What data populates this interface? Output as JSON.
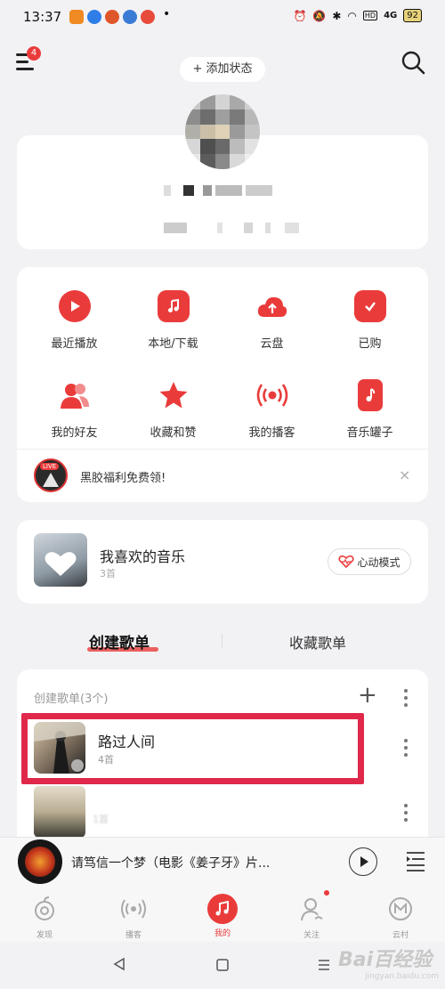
{
  "status_bar": {
    "time": "13:37",
    "dot": "•",
    "network": "4G",
    "hd": "HD",
    "battery": "92"
  },
  "header": {
    "menu_badge": "4",
    "add_status_label": "+ 添加状态"
  },
  "quick_grid": {
    "items": [
      {
        "label": "最近播放",
        "icon": "play-icon"
      },
      {
        "label": "本地/下载",
        "icon": "music-note-icon"
      },
      {
        "label": "云盘",
        "icon": "cloud-upload-icon"
      },
      {
        "label": "已购",
        "icon": "shopping-bag-icon"
      },
      {
        "label": "我的好友",
        "icon": "friends-icon"
      },
      {
        "label": "收藏和赞",
        "icon": "star-icon"
      },
      {
        "label": "我的播客",
        "icon": "podcast-icon"
      },
      {
        "label": "音乐罐子",
        "icon": "music-jar-icon"
      }
    ]
  },
  "promo": {
    "live_tag": "LIVE",
    "text": "黑胶福利免费领!",
    "close": "×"
  },
  "liked": {
    "title": "我喜欢的音乐",
    "count": "3首",
    "heartbeat_label": "心动模式"
  },
  "tabs": {
    "created": "创建歌单",
    "collected": "收藏歌单"
  },
  "playlists": {
    "header": "创建歌单(3个)",
    "items": [
      {
        "title": "路过人间",
        "count": "4首"
      },
      {
        "title": "",
        "count": "1首"
      }
    ]
  },
  "player": {
    "song_title": "请笃信一个梦（电影《姜子牙》片..."
  },
  "bottom_nav": {
    "items": [
      {
        "label": "发现",
        "icon": "discover-icon"
      },
      {
        "label": "播客",
        "icon": "podcast-icon"
      },
      {
        "label": "我的",
        "icon": "my-music-icon"
      },
      {
        "label": "关注",
        "icon": "follow-icon"
      },
      {
        "label": "云村",
        "icon": "cloud-village-icon"
      }
    ]
  },
  "watermark": {
    "brand": "Bai百经验",
    "sub": "jingyan.baidu.com"
  },
  "colors": {
    "accent": "#ea3b3b",
    "highlight": "#e0284a"
  }
}
